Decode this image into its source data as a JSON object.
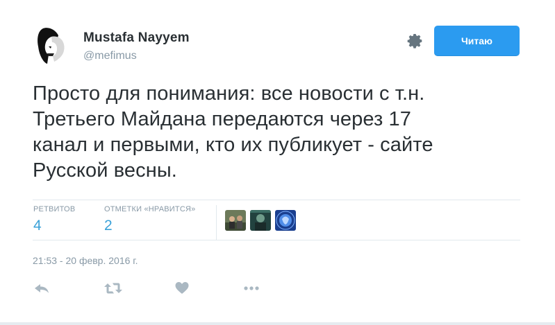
{
  "tweet": {
    "display_name": "Mustafa Nayyem",
    "username": "@mefimus",
    "follow_label": "Читаю",
    "text": "Просто для понимания: все новости с т.н.\nТретьего Майдана передаются через 17\nканал и первыми, кто их публикует - сайте\nРусской весны.",
    "stats": {
      "retweets_label": "РЕТВИТОВ",
      "retweets_value": "4",
      "likes_label": "ОТМЕТКИ «НРАВИТСЯ»",
      "likes_value": "2"
    },
    "liker_avatars": [
      "avatar-1",
      "avatar-2",
      "avatar-3"
    ],
    "timestamp": "21:53 - 20 февр. 2016 г.",
    "actions": [
      "reply-icon",
      "retweet-icon",
      "heart-icon",
      "more-icon"
    ]
  },
  "colors": {
    "accent": "#2b9bf0",
    "stat_value": "#3aa1d8",
    "muted": "#8899a6",
    "text": "#292f33",
    "icon": "#aab8c2"
  }
}
